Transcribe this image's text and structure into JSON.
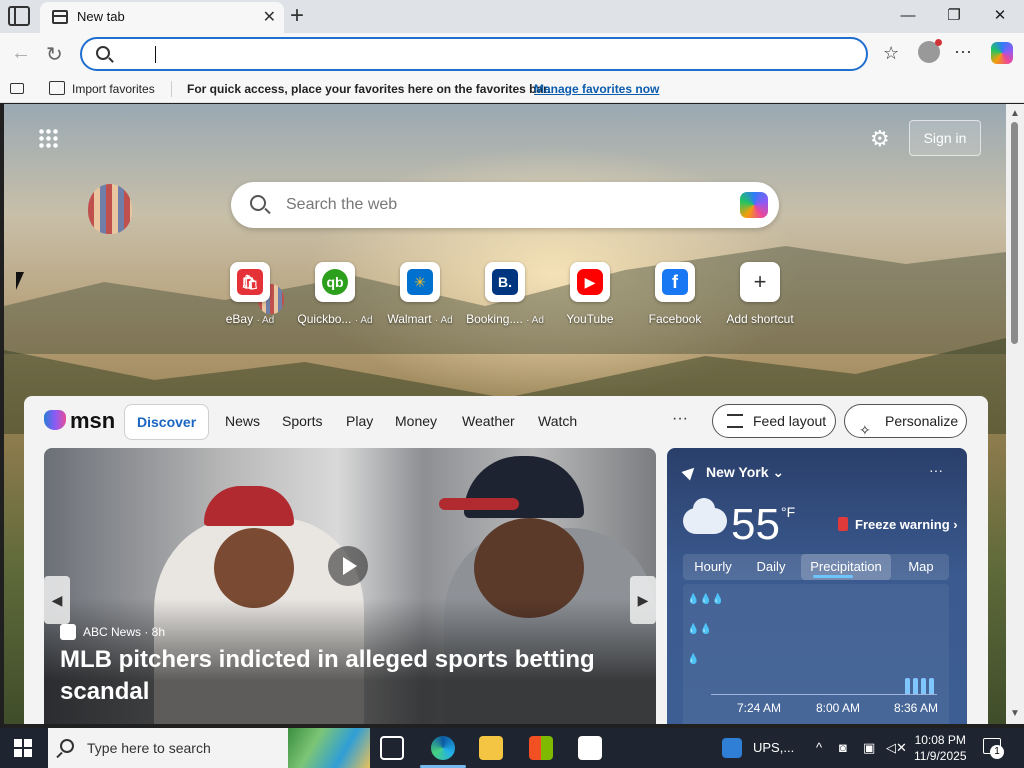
{
  "browser": {
    "tab_title": "New tab",
    "tab_close": "✕",
    "new_tab_icon": "+",
    "window_controls": {
      "minimize": "—",
      "maximize": "❐",
      "close": "✕"
    },
    "back_icon": "←",
    "refresh_icon": "↻",
    "favorite_icon": "☆",
    "more_icon": "···"
  },
  "favbar": {
    "import_label": "Import favorites",
    "hint": "For quick access, place your favorites here on the favorites bar.",
    "manage_link": "Manage favorites now"
  },
  "newtab": {
    "signin_label": "Sign in",
    "gear_icon": "⚙",
    "search_placeholder": "Search the web",
    "shortcuts": [
      {
        "label": "eBay",
        "ad": "· Ad",
        "glyph": "🛍",
        "color": "#e53238"
      },
      {
        "label": "Quickbo...",
        "ad": "· Ad",
        "glyph": "qb",
        "color": "#2ca01c"
      },
      {
        "label": "Walmart",
        "ad": "· Ad",
        "glyph": "✳",
        "color": "#0071ce"
      },
      {
        "label": "Booking....",
        "ad": "· Ad",
        "glyph": "B.",
        "color": "#003580"
      },
      {
        "label": "YouTube",
        "ad": "",
        "glyph": "▶",
        "color": "#ff0000"
      },
      {
        "label": "Facebook",
        "ad": "",
        "glyph": "f",
        "color": "#1877f2"
      },
      {
        "label": "Add shortcut",
        "ad": "",
        "glyph": "+",
        "color": "#ffffff"
      }
    ]
  },
  "feed": {
    "logo": "msn",
    "nav": [
      "Discover",
      "News",
      "Sports",
      "Play",
      "Money",
      "Weather",
      "Watch"
    ],
    "more": "···",
    "feed_layout_label": "Feed layout",
    "personalize_label": "Personalize",
    "hero": {
      "source": "ABC News · 8h",
      "headline": "MLB pitchers indicted in alleged sports betting scandal",
      "prev_icon": "◀",
      "next_icon": "▶"
    }
  },
  "weather": {
    "location": "New York",
    "dropdown": "⌄",
    "more": "···",
    "temperature": "55",
    "unit": "°F",
    "alert": "Freeze warning",
    "alert_arrow": "›",
    "tabs": [
      "Hourly",
      "Daily",
      "Precipitation",
      "Map"
    ],
    "active_tab": "Precipitation",
    "chart_ticks": [
      "7:24 AM",
      "8:00 AM",
      "8:36 AM"
    ]
  },
  "taskbar": {
    "search_placeholder": "Type here to search",
    "ups_label": "UPS,...",
    "time": "10:08 PM",
    "date": "11/9/2025",
    "notification_count": "1",
    "chevron": "^"
  }
}
